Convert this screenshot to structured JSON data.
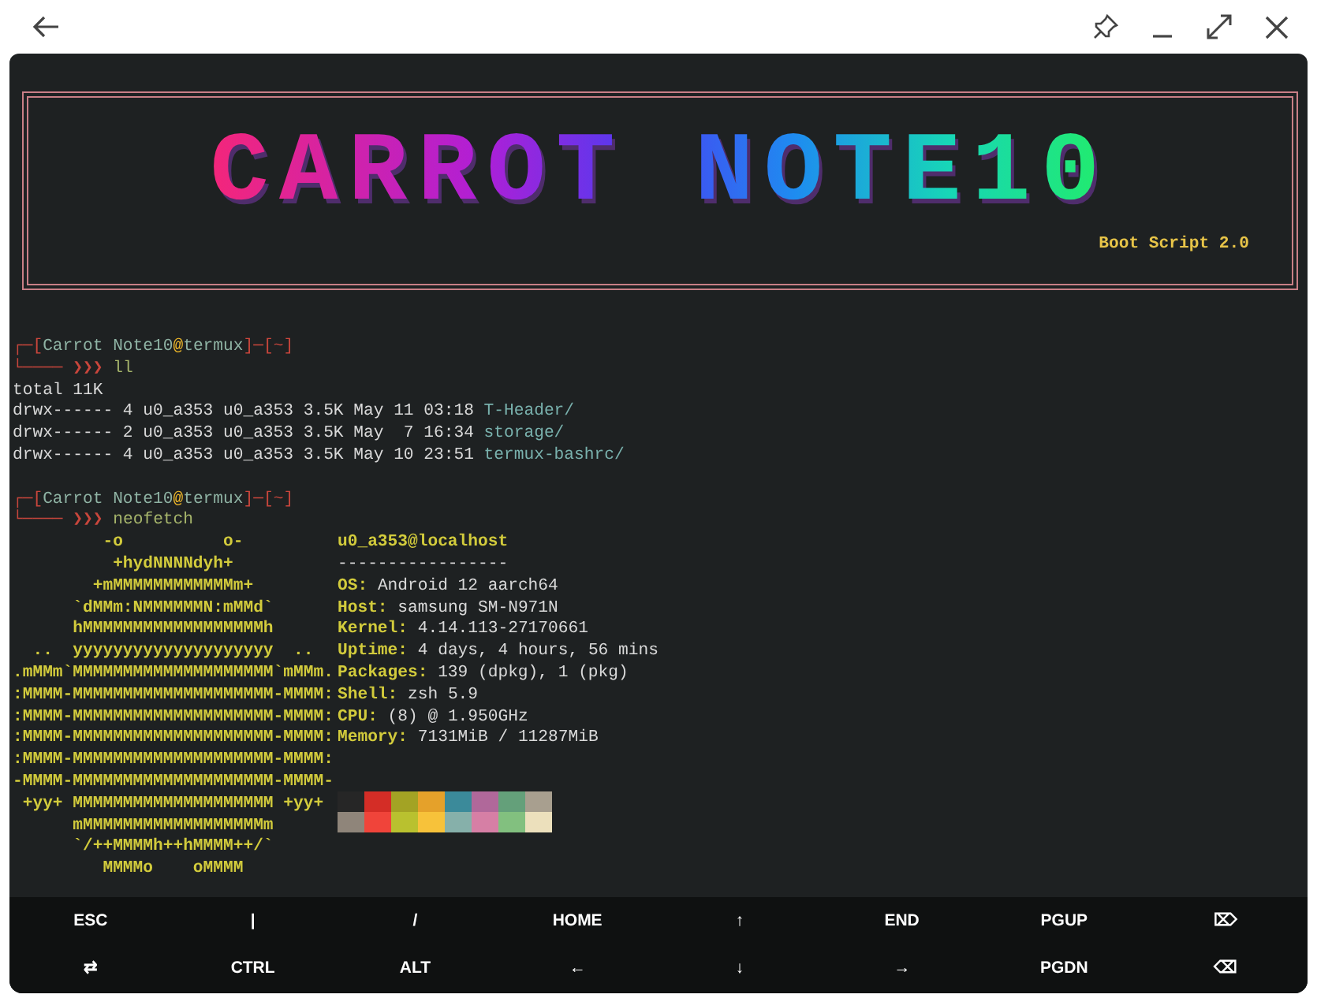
{
  "banner": {
    "title": "CARROT NOTE10",
    "subtitle": "Boot Script 2.0"
  },
  "sessions": [
    {
      "prompt": [
        {
          "text": "┌─[",
          "kind": "frame"
        },
        {
          "text": "Carrot Note10",
          "kind": "user"
        },
        {
          "text": "@",
          "kind": "at"
        },
        {
          "text": "termux",
          "kind": "user"
        },
        {
          "text": "]─[",
          "kind": "frame"
        },
        {
          "text": "~",
          "kind": "frame"
        },
        {
          "text": "]",
          "kind": "frame"
        }
      ],
      "command_line": [
        {
          "text": "└──── ❯❯❯ ",
          "kind": "frame"
        },
        {
          "text": "ll",
          "kind": "command"
        }
      ],
      "output": [
        [
          {
            "text": "total 11K",
            "kind": "plain"
          }
        ],
        [
          {
            "text": "drwx------ 4 u0_a353 u0_a353 3.5K May 11 03:18 ",
            "kind": "plain"
          },
          {
            "text": "T-Header/",
            "kind": "dir"
          }
        ],
        [
          {
            "text": "drwx------ 2 u0_a353 u0_a353 3.5K May  7 16:34 ",
            "kind": "plain"
          },
          {
            "text": "storage/",
            "kind": "dir"
          }
        ],
        [
          {
            "text": "drwx------ 4 u0_a353 u0_a353 3.5K May 10 23:51 ",
            "kind": "plain"
          },
          {
            "text": "termux-bashrc/",
            "kind": "dir"
          }
        ]
      ]
    },
    {
      "prompt": [
        {
          "text": "┌─[",
          "kind": "frame"
        },
        {
          "text": "Carrot Note10",
          "kind": "user"
        },
        {
          "text": "@",
          "kind": "at"
        },
        {
          "text": "termux",
          "kind": "user"
        },
        {
          "text": "]─[",
          "kind": "frame"
        },
        {
          "text": "~",
          "kind": "frame"
        },
        {
          "text": "]",
          "kind": "frame"
        }
      ],
      "command_line": [
        {
          "text": "└──── ❯❯❯ ",
          "kind": "frame"
        },
        {
          "text": "neofetch",
          "kind": "command"
        }
      ]
    }
  ],
  "neofetch": {
    "art": [
      "         -o          o-",
      "          +hydNNNNdyh+",
      "        +mMMMMMMMMMMMMm+",
      "      `dMMm:NMMMMMMN:mMMd`",
      "      hMMMMMMMMMMMMMMMMMMh",
      "  ..  yyyyyyyyyyyyyyyyyyyy  ..",
      ".mMMm`MMMMMMMMMMMMMMMMMMMM`mMMm.",
      ":MMMM-MMMMMMMMMMMMMMMMMMMM-MMMM:",
      ":MMMM-MMMMMMMMMMMMMMMMMMMM-MMMM:",
      ":MMMM-MMMMMMMMMMMMMMMMMMMM-MMMM:",
      ":MMMM-MMMMMMMMMMMMMMMMMMMM-MMMM:",
      "-MMMM-MMMMMMMMMMMMMMMMMMMM-MMMM-",
      " +yy+ MMMMMMMMMMMMMMMMMMMM +yy+",
      "      mMMMMMMMMMMMMMMMMMMm",
      "      `/++MMMMh++hMMMM++/`",
      "         MMMMo    oMMMM"
    ],
    "header": "u0_a353@localhost",
    "rule": "-----------------",
    "fields": [
      {
        "label": "OS:",
        "value": "Android 12 aarch64"
      },
      {
        "label": "Host:",
        "value": "samsung SM-N971N"
      },
      {
        "label": "Kernel:",
        "value": "4.14.113-27170661"
      },
      {
        "label": "Uptime:",
        "value": "4 days, 4 hours, 56 mins"
      },
      {
        "label": "Packages:",
        "value": "139 (dpkg), 1 (pkg)"
      },
      {
        "label": "Shell:",
        "value": "zsh 5.9"
      },
      {
        "label": "CPU:",
        "value": "(8) @ 1.950GHz"
      },
      {
        "label": "Memory:",
        "value": "7131MiB / 11287MiB"
      }
    ],
    "palette": [
      {
        "color": "#262626"
      },
      {
        "color": "#d42d26"
      },
      {
        "color": "#a3a324"
      },
      {
        "color": "#e5a12a"
      },
      {
        "color": "#3b8a9a"
      },
      {
        "color": "#b0689a"
      },
      {
        "color": "#64a07a"
      },
      {
        "color": "#a89f8f"
      },
      {
        "color": "#8f857a"
      },
      {
        "color": "#f0443a"
      },
      {
        "color": "#b9c12f"
      },
      {
        "color": "#f7c23a"
      },
      {
        "color": "#86b0aa"
      },
      {
        "color": "#d67fa5"
      },
      {
        "color": "#82c07f"
      },
      {
        "color": "#ece0bc"
      }
    ]
  },
  "keys": [
    {
      "label": "ESC"
    },
    {
      "label": "|"
    },
    {
      "label": "/"
    },
    {
      "label": "HOME"
    },
    {
      "label": "↑"
    },
    {
      "label": "END"
    },
    {
      "label": "PGUP"
    },
    {
      "label": "⌦"
    },
    {
      "label": "⇄"
    },
    {
      "label": "CTRL"
    },
    {
      "label": "ALT"
    },
    {
      "label": "←"
    },
    {
      "label": "↓"
    },
    {
      "label": "→"
    },
    {
      "label": "PGDN"
    },
    {
      "label": "⌫"
    }
  ]
}
